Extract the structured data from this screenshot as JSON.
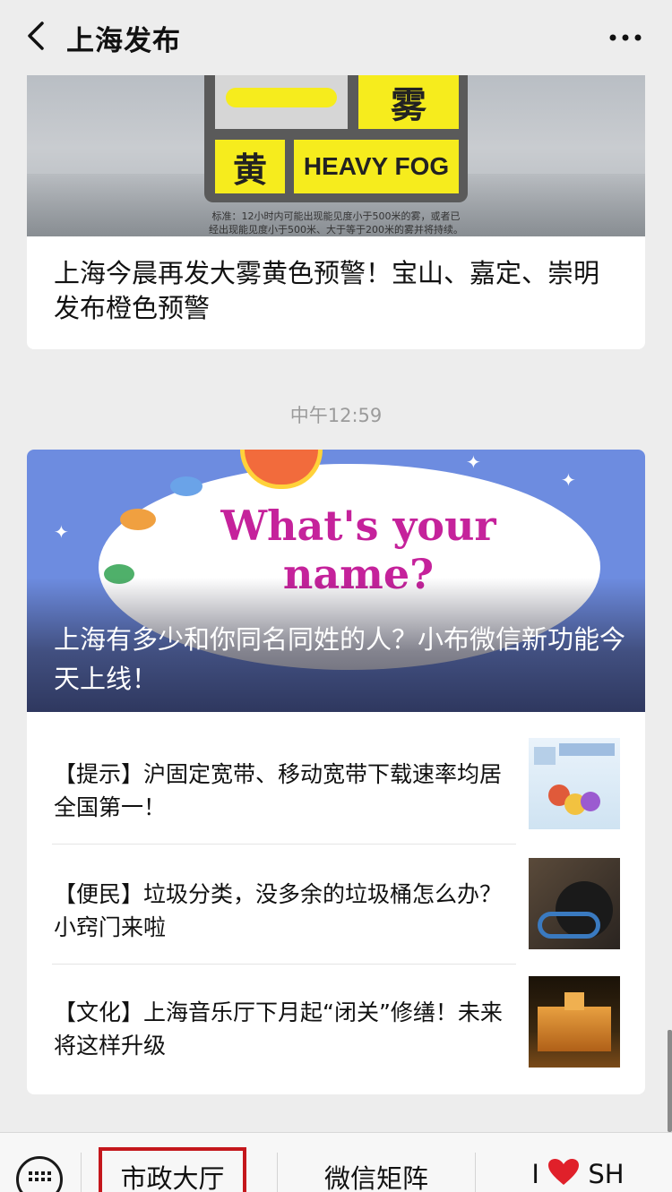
{
  "header": {
    "title": "上海发布",
    "back_icon": "chevron-left-icon",
    "more_icon": "more-dots-icon"
  },
  "card1": {
    "banner": {
      "sign_top_char": "雾",
      "sign_color_char": "黄",
      "sign_text": "HEAVY FOG",
      "caption_line1": "标准：12小时内可能出现能见度小于500米的雾，或者已",
      "caption_line2": "经出现能见度小于500米、大于等于200米的雾并将持续。"
    },
    "title": "上海今晨再发大雾黄色预警！宝山、嘉定、崇明发布橙色预警"
  },
  "timestamp": "中午12:59",
  "card2": {
    "hero": {
      "image_heading": "What's your name?",
      "title": "上海有多少和你同名同姓的人？小布微信新功能今天上线！"
    },
    "items": [
      {
        "text": "【提示】沪固定宽带、移动宽带下载速率均居全国第一！",
        "thumb": "broadband-infographic"
      },
      {
        "text": "【便民】垃圾分类，没多余的垃圾桶怎么办？小窍门来啦",
        "thumb": "trash-bin-photo"
      },
      {
        "text": "【文化】上海音乐厅下月起“闭关”修缮！未来将这样升级",
        "thumb": "concert-hall-night-photo"
      }
    ]
  },
  "bottom_menu": {
    "keyboard_icon": "keyboard-icon",
    "items": [
      {
        "label": "市政大厅"
      },
      {
        "label": "微信矩阵"
      },
      {
        "label_prefix": "I",
        "label_suffix": "SH",
        "icon": "heart-icon"
      }
    ],
    "colors": {
      "highlight": "#c4171c",
      "heart": "#e0202a"
    }
  }
}
